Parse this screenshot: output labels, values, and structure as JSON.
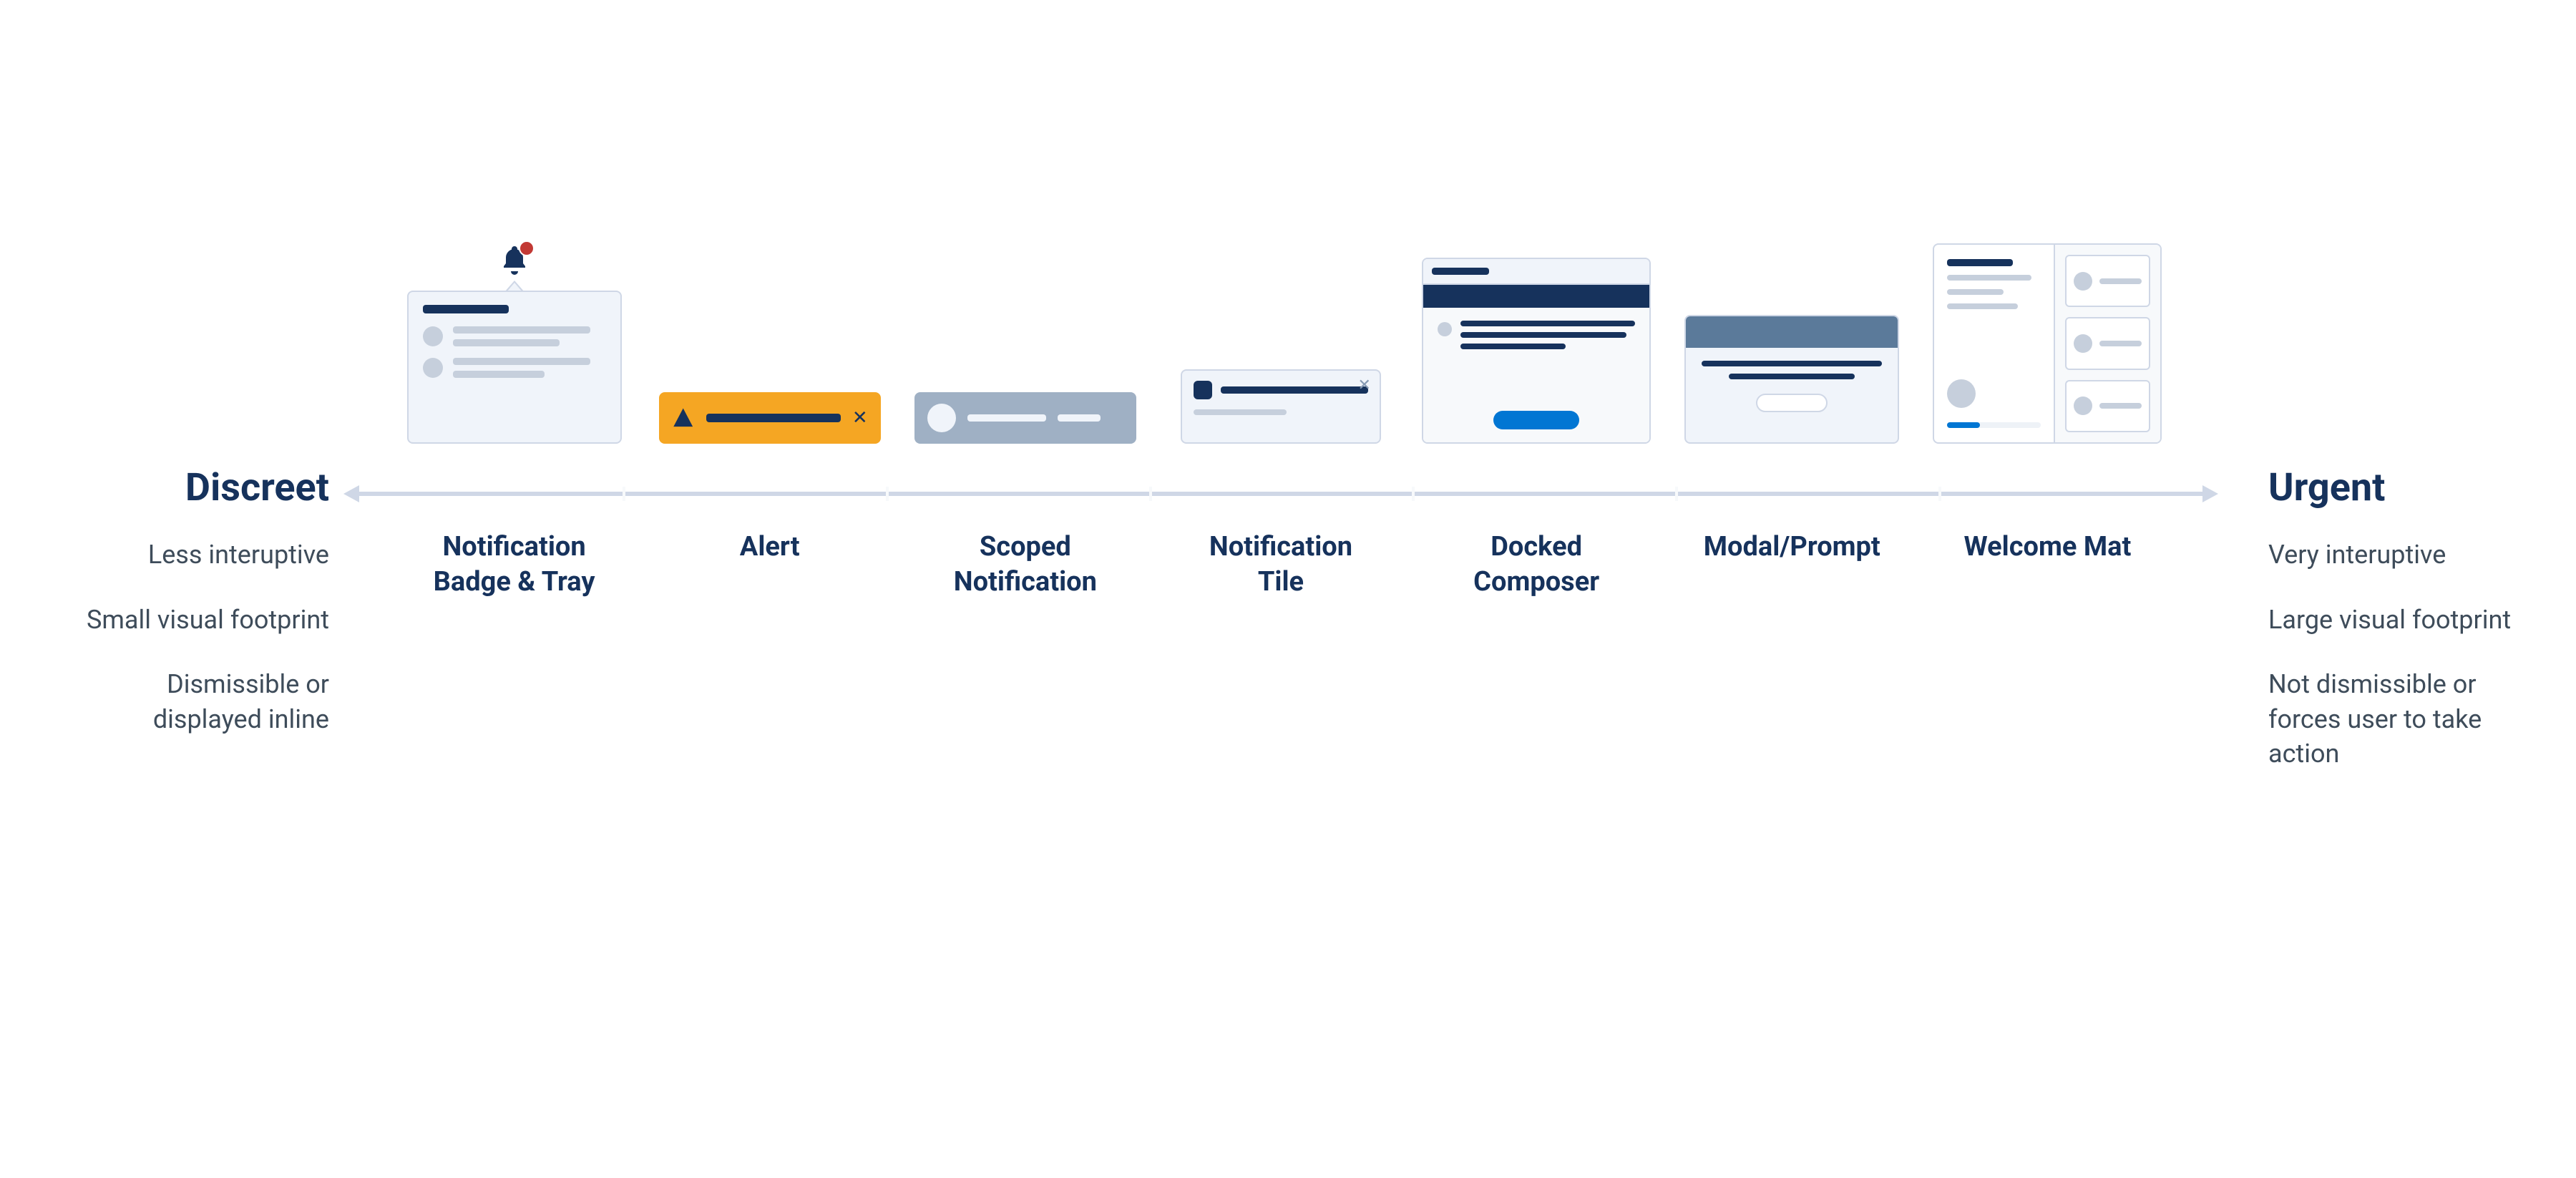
{
  "left": {
    "heading": "Discreet",
    "items": [
      "Less interuptive",
      "Small visual footprint",
      "Dismissible or displayed inline"
    ]
  },
  "right": {
    "heading": "Urgent",
    "items": [
      "Very interuptive",
      "Large visual footprint",
      "Not dismissible or forces user to take action"
    ]
  },
  "components": [
    {
      "name": "Notification Badge & Tray",
      "line2": ""
    },
    {
      "name": "Alert",
      "line2": ""
    },
    {
      "name": "Scoped",
      "line2": "Notification"
    },
    {
      "name": "Notification",
      "line2": "Tile"
    },
    {
      "name": "Docked",
      "line2": "Composer"
    },
    {
      "name": "Modal/Prompt",
      "line2": ""
    },
    {
      "name": "Welcome Mat",
      "line2": ""
    }
  ],
  "labels_2line": {
    "0": {
      "a": "Notification",
      "b": "Badge & Tray"
    },
    "2": {
      "a": "Scoped",
      "b": "Notification"
    },
    "3": {
      "a": "Notification",
      "b": "Tile"
    },
    "4": {
      "a": "Docked",
      "b": "Composer"
    }
  }
}
